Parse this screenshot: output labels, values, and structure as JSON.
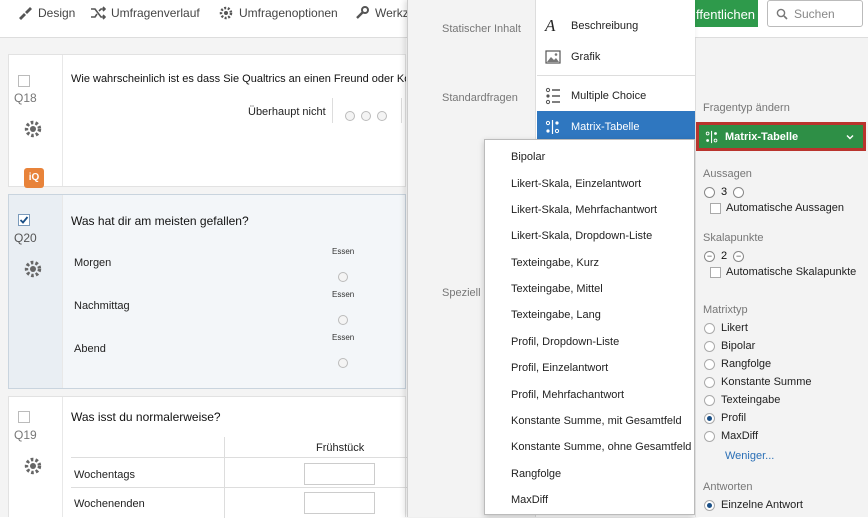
{
  "toolbar": {
    "design": "Design",
    "history": "Umfragenverlauf",
    "options": "Umfragenoptionen",
    "tools": "Werkz",
    "publish": "ffentlichen",
    "search_placeholder": "Suchen"
  },
  "questions": {
    "q18": {
      "number": "Q18",
      "text": "Wie wahrscheinlich ist es dass Sie Qualtrics an einen Freund oder Kolleg",
      "scale_left": "Überhaupt nicht",
      "iq_badge": "iQ"
    },
    "q20": {
      "number": "Q20",
      "text": "Was hat dir am meisten gefallen?",
      "rows": [
        "Morgen",
        "Nachmittag",
        "Abend"
      ],
      "column_label": "Essen"
    },
    "q19": {
      "number": "Q19",
      "text": "Was isst du normalerweise?",
      "column": "Frühstück",
      "rows": [
        "Wochentags",
        "Wochenenden"
      ]
    }
  },
  "popup": {
    "groups": {
      "static": "Statischer Inhalt",
      "standard": "Standardfragen",
      "special": "Speziell"
    },
    "items": {
      "description": "Beschreibung",
      "graphic": "Grafik",
      "multiple_choice": "Multiple Choice",
      "matrix": "Matrix-Tabelle"
    }
  },
  "submenu": {
    "items": [
      "Bipolar",
      "Likert-Skala, Einzelantwort",
      "Likert-Skala, Mehrfachantwort",
      "Likert-Skala, Dropdown-Liste",
      "Texteingabe, Kurz",
      "Texteingabe, Mittel",
      "Texteingabe, Lang",
      "Profil, Dropdown-Liste",
      "Profil, Einzelantwort",
      "Profil, Mehrfachantwort",
      "Konstante Summe, mit Gesamtfeld",
      "Konstante Summe, ohne Gesamtfeld",
      "Rangfolge",
      "MaxDiff"
    ]
  },
  "panel": {
    "change_type_label": "Fragentyp ändern",
    "current_type": "Matrix-Tabelle",
    "statements": {
      "label": "Aussagen",
      "value": "3",
      "auto": "Automatische Aussagen"
    },
    "scale_points": {
      "label": "Skalapunkte",
      "value": "2",
      "auto": "Automatische Skalapunkte"
    },
    "matrix_type": {
      "label": "Matrixtyp",
      "options": [
        "Likert",
        "Bipolar",
        "Rangfolge",
        "Konstante Summe",
        "Texteingabe",
        "Profil",
        "MaxDiff"
      ],
      "selected": "Profil"
    },
    "less_link": "Weniger...",
    "answers": {
      "label": "Antworten",
      "option": "Einzelne Antwort"
    }
  },
  "colors": {
    "accent_blue": "#2f77c0",
    "green": "#2e8f46",
    "highlight_red": "#b9342d",
    "iq_orange": "#e8833a"
  },
  "icons": [
    "brush-icon",
    "shuffle-icon",
    "gear-icon",
    "wrench-icon",
    "search-icon",
    "text-a-icon",
    "image-icon",
    "list-icon",
    "matrix-icon",
    "chevron-down-icon"
  ]
}
